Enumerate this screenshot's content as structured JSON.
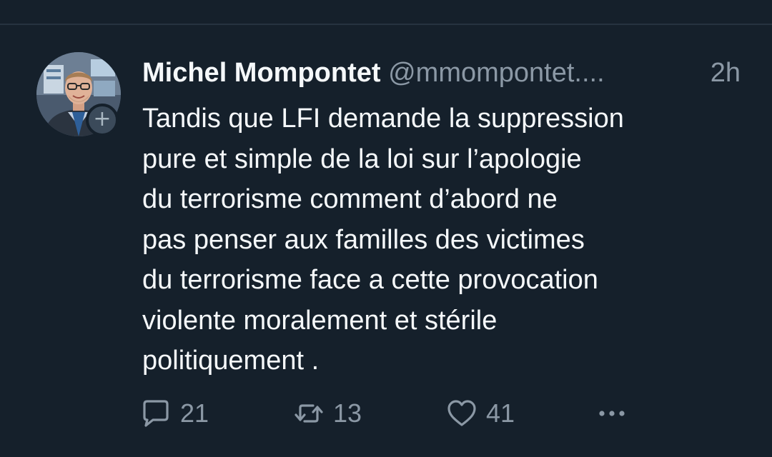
{
  "tweet": {
    "author": {
      "display_name": "Michel Mompontet",
      "handle": "@mmompontet....",
      "avatar_icon": "profile-photo",
      "follow_badge": "+"
    },
    "timestamp": "2h",
    "text": "Tandis que LFI demande la suppression\npure et simple de la loi sur l’apologie\ndu terrorisme comment d’abord ne\npas penser aux familles des victimes\ndu terrorisme face a cette provocation\nviolente moralement et stérile\npolitiquement .",
    "actions": {
      "reply": {
        "icon": "comment-icon",
        "count": "21"
      },
      "retweet": {
        "icon": "retweet-icon",
        "count": "13"
      },
      "like": {
        "icon": "heart-icon",
        "count": "41"
      },
      "more": {
        "icon": "more-icon"
      }
    }
  },
  "colors": {
    "background": "#15202b",
    "primary_text": "#f5f8fa",
    "secondary_text": "#8b98a5",
    "divider": "#263340"
  }
}
